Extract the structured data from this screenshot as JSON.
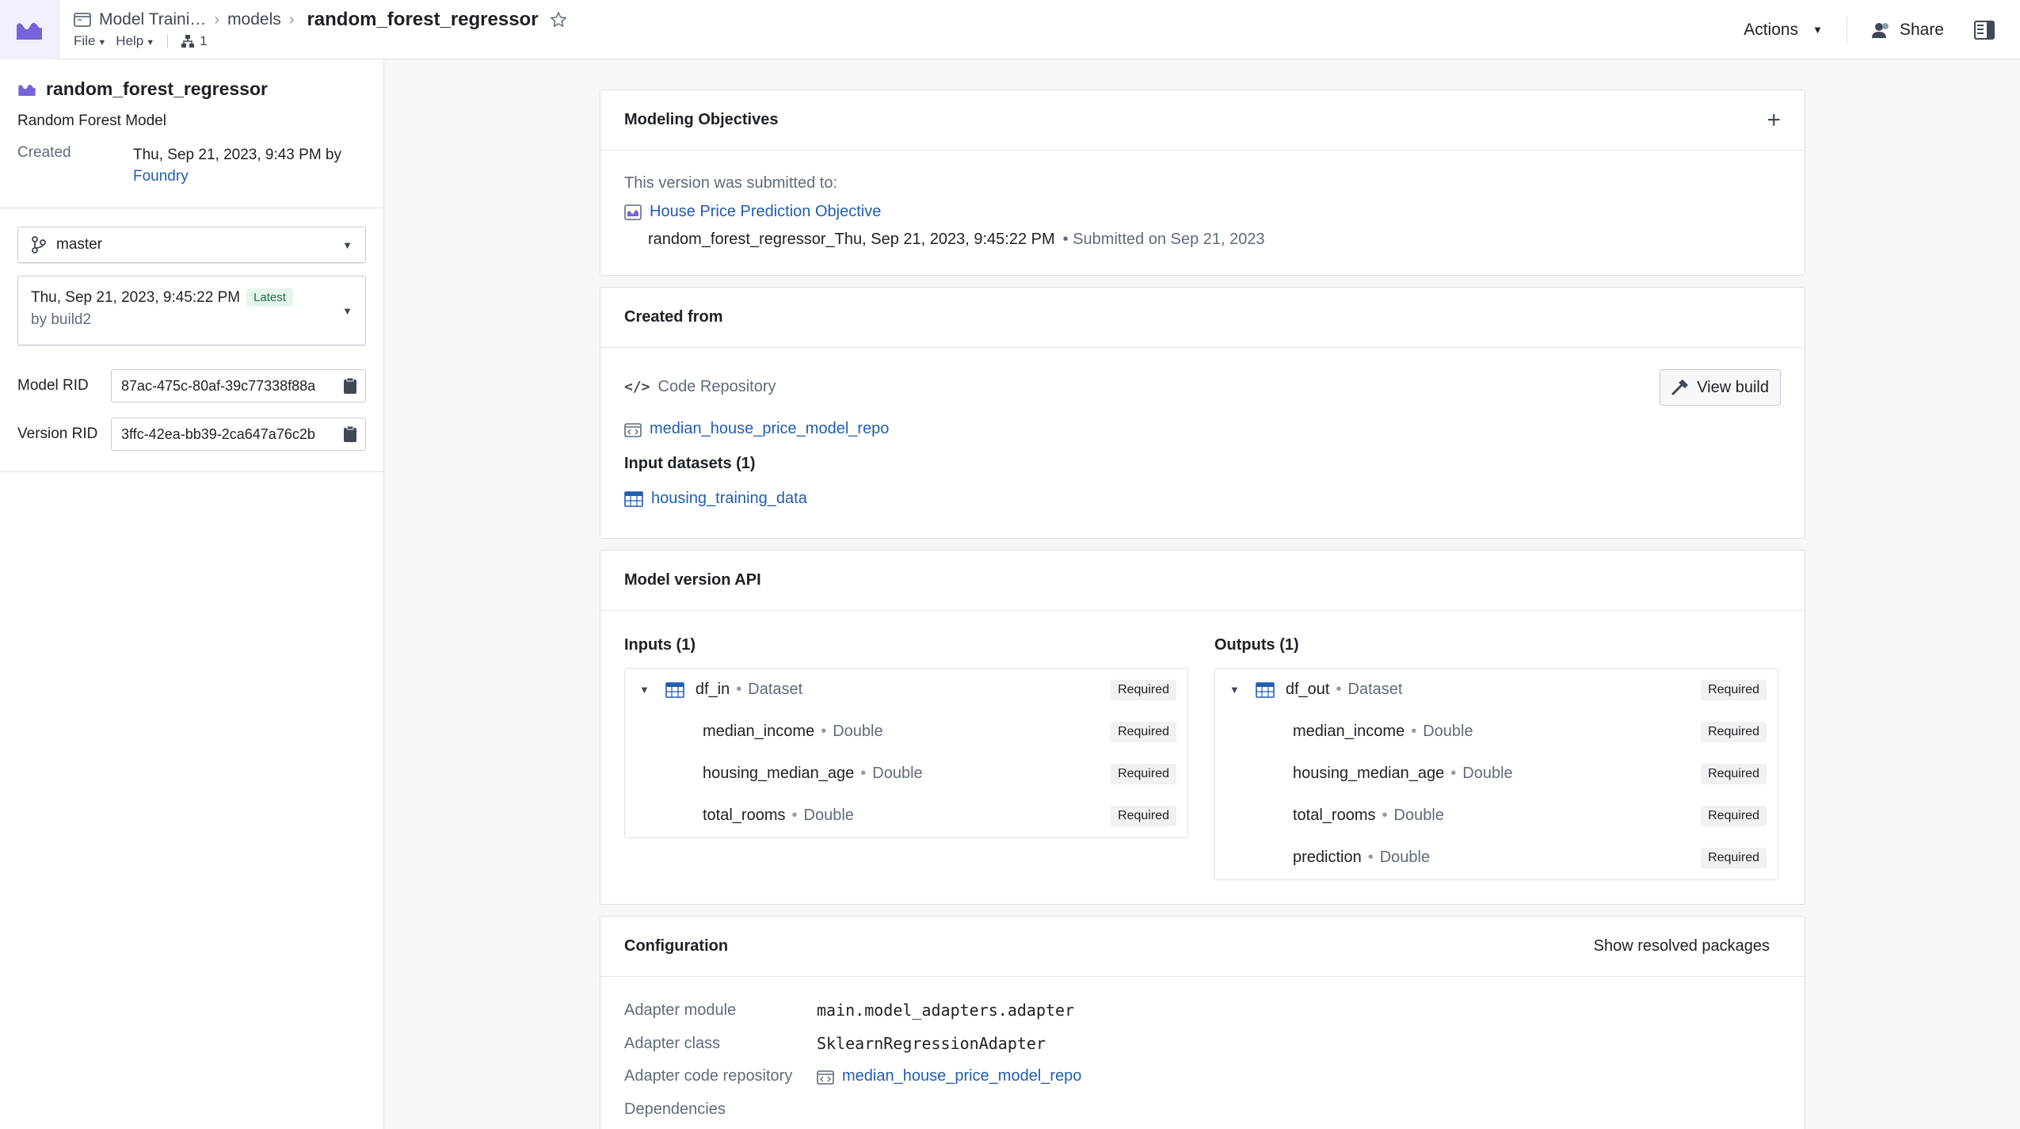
{
  "topbar": {
    "breadcrumbs": [
      "Model Traini…",
      "models"
    ],
    "current": "random_forest_regressor",
    "menu": [
      "File",
      "Help"
    ],
    "branch_count": "1",
    "actions_label": "Actions",
    "share_label": "Share"
  },
  "sidebar": {
    "title": "random_forest_regressor",
    "subtitle": "Random Forest Model",
    "created_label": "Created",
    "created_value": "Thu, Sep 21, 2023, 9:43 PM by",
    "created_by": "Foundry",
    "branch": "master",
    "version_date": "Thu, Sep 21, 2023, 9:45:22 PM",
    "version_badge": "Latest",
    "version_by": "by build2",
    "model_rid_label": "Model RID",
    "model_rid": "87ac-475c-80af-39c77338f88a",
    "version_rid_label": "Version RID",
    "version_rid": "3ffc-42ea-bb39-2ca647a76c2b"
  },
  "objectives": {
    "title": "Modeling Objectives",
    "submitted_text": "This version was submitted to:",
    "objective_link": "House Price Prediction Objective",
    "submission_name": "random_forest_regressor_Thu, Sep 21, 2023, 9:45:22 PM",
    "submission_meta": "• Submitted on Sep 21, 2023"
  },
  "created_from": {
    "title": "Created from",
    "source_type": "Code Repository",
    "view_build_label": "View build",
    "repo_link": "median_house_price_model_repo",
    "input_datasets_label": "Input datasets (1)",
    "dataset_link": "housing_training_data"
  },
  "api": {
    "title": "Model version API",
    "inputs_label": "Inputs (1)",
    "outputs_label": "Outputs (1)",
    "required": "Required",
    "input": {
      "name": "df_in",
      "type": "Dataset",
      "columns": [
        {
          "name": "median_income",
          "type": "Double"
        },
        {
          "name": "housing_median_age",
          "type": "Double"
        },
        {
          "name": "total_rooms",
          "type": "Double"
        }
      ]
    },
    "output": {
      "name": "df_out",
      "type": "Dataset",
      "columns": [
        {
          "name": "median_income",
          "type": "Double"
        },
        {
          "name": "housing_median_age",
          "type": "Double"
        },
        {
          "name": "total_rooms",
          "type": "Double"
        },
        {
          "name": "prediction",
          "type": "Double"
        }
      ]
    }
  },
  "configuration": {
    "title": "Configuration",
    "show_packages_label": "Show resolved packages",
    "adapter_module_label": "Adapter module",
    "adapter_module": "main.model_adapters.adapter",
    "adapter_class_label": "Adapter class",
    "adapter_class": "SklearnRegressionAdapter",
    "adapter_repo_label": "Adapter code repository",
    "adapter_repo": "median_house_price_model_repo",
    "dependencies_label": "Dependencies"
  },
  "colors": {
    "accent": "#7961db",
    "link": "#215db0"
  }
}
